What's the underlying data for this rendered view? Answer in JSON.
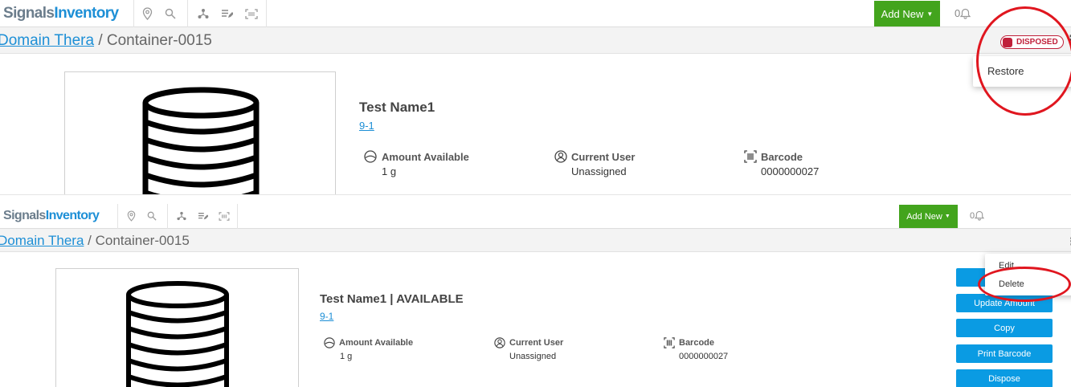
{
  "app": {
    "brand_part1": "Signals",
    "brand_part2": "Inventory"
  },
  "toolbar": {
    "add_new_label": "Add New",
    "notification_count": "0"
  },
  "breadcrumb": {
    "parent": "Domain Thera",
    "separator": "/",
    "current": "Container-0015"
  },
  "view1": {
    "status_badge": "DISPOSED",
    "title": "Test Name1",
    "location": "9-1",
    "fields": {
      "amount_label": "Amount Available",
      "amount_value": "1 g",
      "user_label": "Current User",
      "user_value": "Unassigned",
      "barcode_label": "Barcode",
      "barcode_value": "0000000027"
    },
    "menu": {
      "restore_label": "Restore"
    }
  },
  "view2": {
    "title": "Test Name1 | AVAILABLE",
    "location": "9-1",
    "fields": {
      "amount_label": "Amount Available",
      "amount_value": "1 g",
      "user_label": "Current User",
      "user_value": "Unassigned",
      "barcode_label": "Barcode",
      "barcode_value": "0000000027"
    },
    "menu": {
      "edit_label": "Edit",
      "delete_label": "Delete"
    },
    "actions": {
      "update_amount_label": "Update Amount",
      "copy_label": "Copy",
      "print_barcode_label": "Print Barcode",
      "dispose_label": "Dispose"
    }
  },
  "colors": {
    "accent": "#1d8fd6",
    "add_new": "#43a41d",
    "action": "#0a9be3",
    "disposed": "#c0203a",
    "annotation": "#e0161f"
  }
}
